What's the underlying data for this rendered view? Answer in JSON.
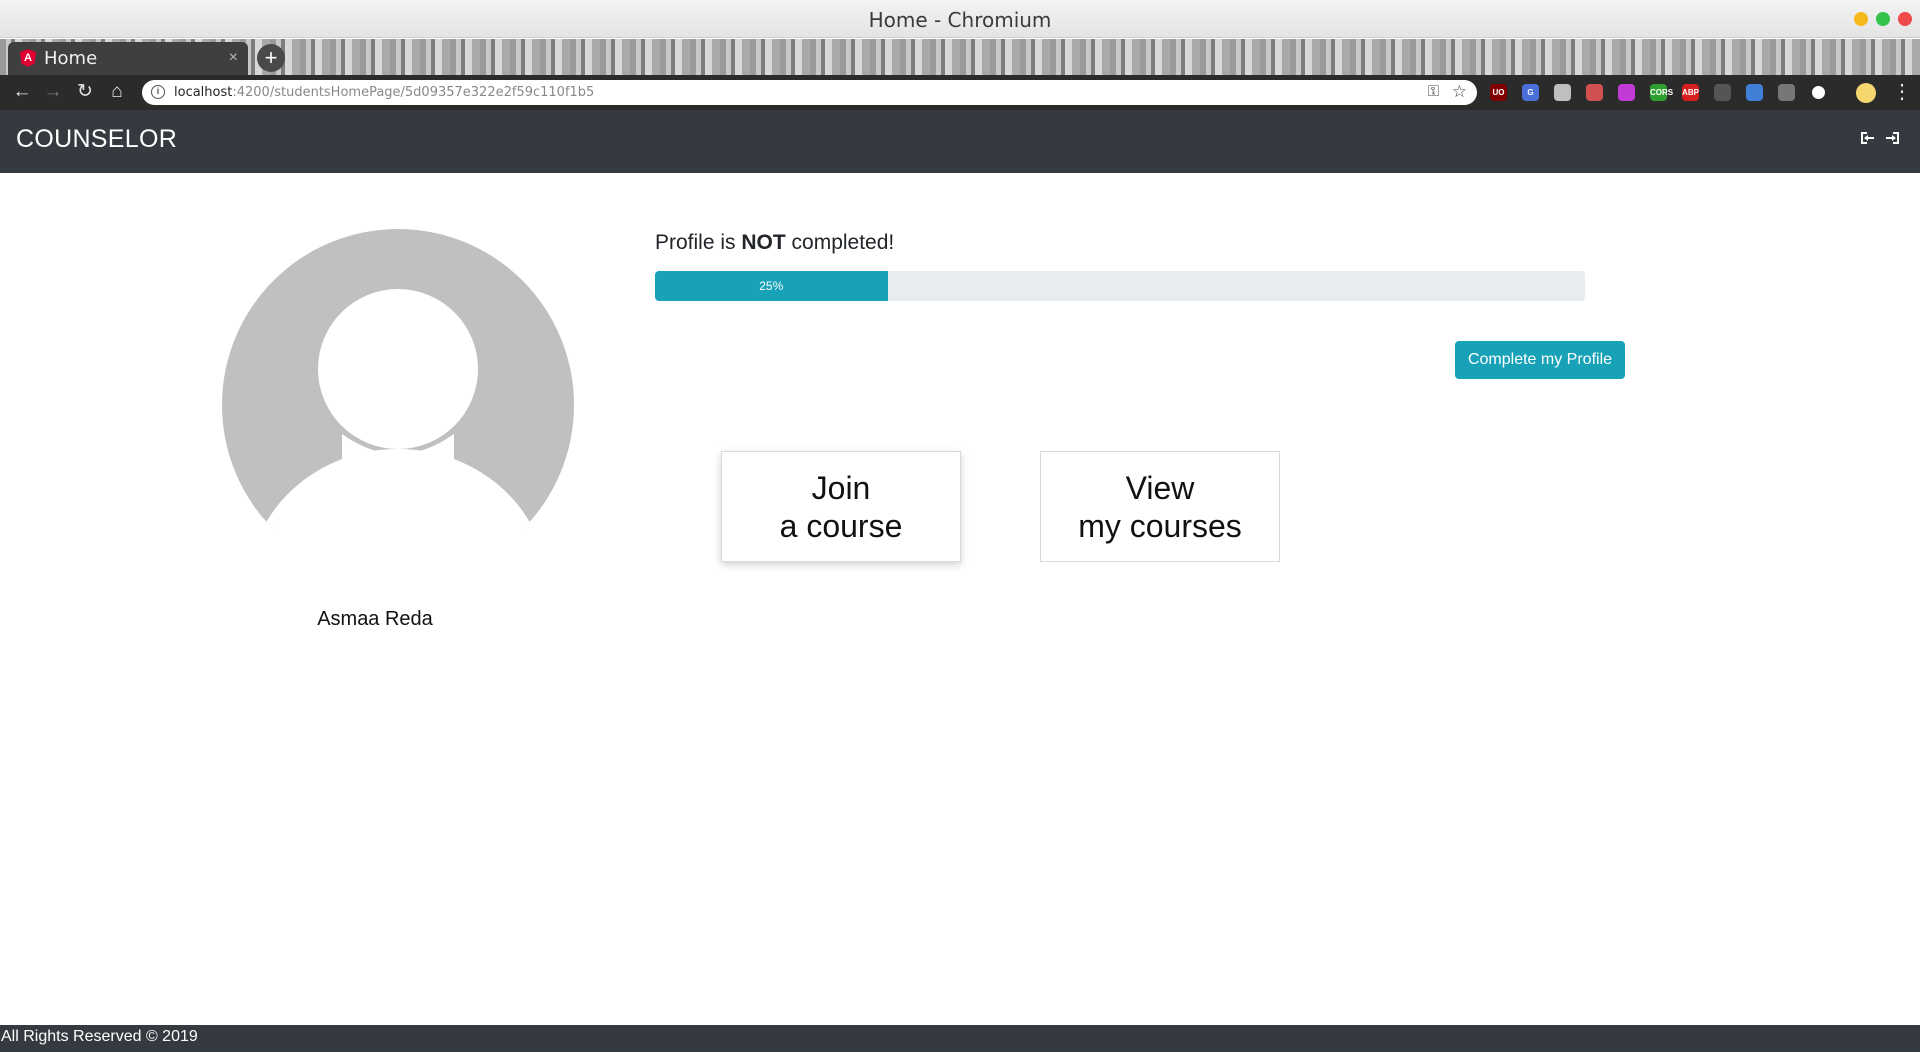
{
  "window": {
    "title": "Home - Chromium"
  },
  "browser": {
    "tab_title": "Home",
    "tab_close": "×",
    "new_tab": "+",
    "url_host": "localhost",
    "url_path": ":4200/studentsHomePage/5d09357e322e2f59c110f1b5",
    "extensions": [
      {
        "name": "ublock",
        "label": "UO",
        "color": "#800000"
      },
      {
        "name": "translate",
        "label": "G",
        "color": "#4a6fd8"
      },
      {
        "name": "docs",
        "label": "",
        "color": "#bfbfbf"
      },
      {
        "name": "pen",
        "label": "",
        "color": "#d05050"
      },
      {
        "name": "octo",
        "label": "",
        "color": "#c23bd6"
      },
      {
        "name": "cors",
        "label": "CORS",
        "color": "#2e9e2e"
      },
      {
        "name": "adblock",
        "label": "ABP",
        "color": "#d62020"
      },
      {
        "name": "misc",
        "label": "",
        "color": "#555555"
      },
      {
        "name": "vpn",
        "label": "",
        "color": "#3f7fd6"
      },
      {
        "name": "download",
        "label": "",
        "color": "#777777"
      },
      {
        "name": "chrome",
        "label": "",
        "color": "#ffffff"
      }
    ]
  },
  "navbar": {
    "brand": "COUNSELOR"
  },
  "profile": {
    "name": "Asmaa Reda",
    "status_prefix": "Profile is ",
    "status_emphasis": "NOT",
    "status_suffix": " completed!",
    "progress_percent": 25,
    "progress_label": "25%",
    "complete_button": "Complete my Profile"
  },
  "actions": {
    "join": {
      "line1": "Join",
      "line2": "a course"
    },
    "view": {
      "line1": "View",
      "line2": "my courses"
    }
  },
  "footer": {
    "text": "All Rights Reserved © 2019"
  },
  "colors": {
    "navbar_bg": "#343a40",
    "accent": "#17a2b8",
    "progress_track": "#e9ecef",
    "avatar_gray": "#c0c0c0"
  }
}
